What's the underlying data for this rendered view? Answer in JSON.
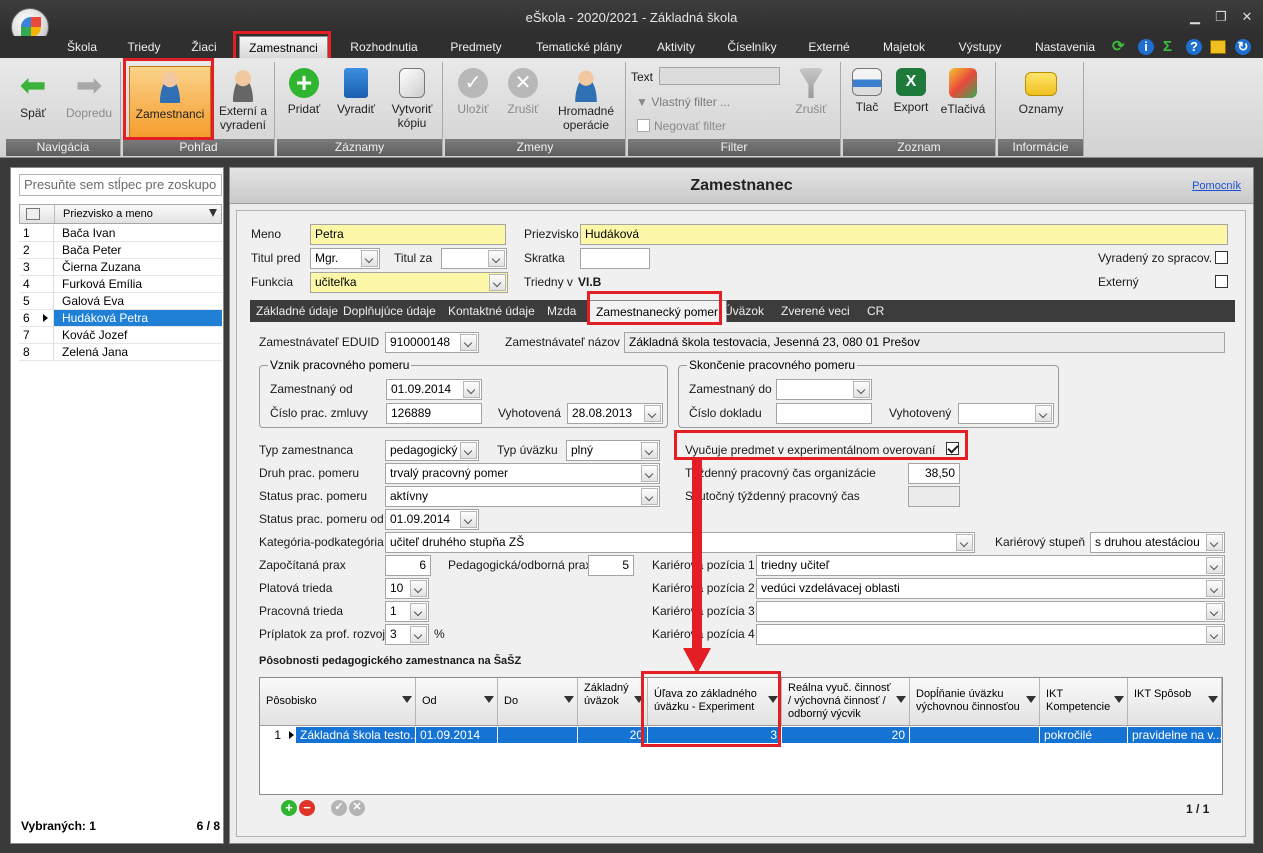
{
  "window": {
    "title": "eŠkola - 2020/2021 - Základná škola"
  },
  "menu": [
    "Škola",
    "Triedy",
    "Žiaci",
    "Zamestnanci",
    "Rozhodnutia",
    "Predmety",
    "Tematické plány",
    "Aktivity",
    "Číselníky",
    "Externé",
    "Majetok",
    "Výstupy",
    "Nastavenia"
  ],
  "ribbon": {
    "groups": [
      "Navigácia",
      "Pohľad",
      "Záznamy",
      "Zmeny",
      "Filter",
      "Zoznam",
      "Informácie"
    ],
    "back": "Späť",
    "forward": "Dopredu",
    "employees": "Zamestnanci",
    "external": "Externí a vyradení",
    "add": "Pridať",
    "remove": "Vyradiť",
    "copy": "Vytvoriť kópiu",
    "save": "Uložiť",
    "cancel": "Zrušiť",
    "bulk": "Hromadné operácie",
    "text_label": "Text",
    "custom_filter": "Vlastný filter ...",
    "negate_filter": "Negovať filter",
    "filter_cancel": "Zrušiť",
    "print": "Tlač",
    "export": "Export",
    "eprint": "eTlačivá",
    "notices": "Oznamy"
  },
  "left": {
    "group_placeholder": "Presuňte sem stĺpec pre zoskupo",
    "column": "Priezvisko a meno",
    "rows": [
      {
        "n": "1",
        "name": "Bača Ivan"
      },
      {
        "n": "2",
        "name": "Bača Peter"
      },
      {
        "n": "3",
        "name": "Čierna Zuzana"
      },
      {
        "n": "4",
        "name": "Furková Emília"
      },
      {
        "n": "5",
        "name": "Galová Eva"
      },
      {
        "n": "6",
        "name": "Hudáková Petra"
      },
      {
        "n": "7",
        "name": "Kováč Jozef"
      },
      {
        "n": "8",
        "name": "Zelená Jana"
      }
    ],
    "selected_label": "Vybraných: 1",
    "count": "6 / 8"
  },
  "main": {
    "title": "Zamestnanec",
    "help": "Pomocník",
    "meno_label": "Meno",
    "meno": "Petra",
    "priezvisko_label": "Priezvisko",
    "priezvisko": "Hudáková",
    "titul_pred_label": "Titul pred",
    "titul_pred": "Mgr.",
    "titul_za_label": "Titul za",
    "titul_za": "",
    "skratka_label": "Skratka",
    "skratka": "",
    "vyradeny_label": "Vyradený zo spracov.",
    "funkcia_label": "Funkcia",
    "funkcia": "učiteľka",
    "triedny_label": "Triedny v",
    "triedny": "VI.B",
    "externy_label": "Externý",
    "tabs": [
      "Základné údaje",
      "Doplňujúce údaje",
      "Kontaktné údaje",
      "Mzda",
      "Zamestnanecký pomer",
      "Úväzok",
      "Zverené veci",
      "CR"
    ]
  },
  "form": {
    "edu_label": "Zamestnávateľ EDUID",
    "edu": "910000148",
    "nazov_label": "Zamestnávateľ názov",
    "nazov": "Základná škola testovacia, Jesenná 23, 080 01 Prešov",
    "vznik_caption": "Vznik pracovného pomeru",
    "od_label": "Zamestnaný od",
    "od": "01.09.2014",
    "zmluva_label": "Číslo prac. zmluvy",
    "zmluva": "126889",
    "vyhot_label": "Vyhotovená",
    "vyhot": "28.08.2013",
    "skonc_caption": "Skončenie pracovného pomeru",
    "do_label": "Zamestnaný do",
    "do": "",
    "doklad_label": "Číslo dokladu",
    "doklad": "",
    "vyhot2_label": "Vyhotovený",
    "vyhot2": "",
    "typ_label": "Typ zamestnanca",
    "typ": "pedagogický",
    "typuv_label": "Typ úväzku",
    "typuv": "plný",
    "druh_label": "Druh prac. pomeru",
    "druh": "trvalý pracovný pomer",
    "status_label": "Status prac. pomeru",
    "status": "aktívny",
    "statusod_label": "Status prac. pomeru od",
    "statusod": "01.09.2014",
    "exp_label": "Vyučuje predmet v experimentálnom overovaní",
    "tyzd_label": "Týždenný pracovný čas organizácie",
    "tyzd": "38,50",
    "skut_label": "Skutočný týždenný pracovný čas",
    "skut": "",
    "kat_label": "Kategória-podkategória",
    "kat": "učiteľ druhého stupňa ZŠ",
    "karst_label": "Kariérový stupeň",
    "karst": "s druhou atestáciou",
    "zap_label": "Započítaná prax",
    "zap": "6",
    "ped_label": "Pedagogická/odborná prax",
    "ped": "5",
    "kp1_label": "Kariérová pozícia 1",
    "kp1": "triedny učiteľ",
    "plat_label": "Platová trieda",
    "plat": "10",
    "kp2_label": "Kariérová pozícia 2",
    "kp2": "vedúci vzdelávacej oblasti",
    "prac_label": "Pracovná trieda",
    "prac": "1",
    "kp3_label": "Kariérová pozícia 3",
    "kp3": "",
    "prip_label": "Príplatok za prof. rozvoj",
    "prip": "3",
    "pct": "%",
    "kp4_label": "Kariérová pozícia 4",
    "kp4": "",
    "section": "Pôsobnosti pedagogického zamestnanca na ŠaŠZ"
  },
  "grid": {
    "headers": [
      "Pôsobisko",
      "Od",
      "Do",
      "Základný úväzok",
      "Úľava zo základného úväzku - Experiment",
      "Reálna vyuč. činnosť / výchovná činnosť / odborný výcvik",
      "Dopĺňanie úväzku výchovnou činnosťou",
      "IKT Kompetencie",
      "IKT Spôsob"
    ],
    "row": {
      "n": "1",
      "posobisko": "Základná škola testo...",
      "od": "01.09.2014",
      "do": "",
      "zakladny": "20",
      "ulava": "3",
      "realna": "20",
      "doplnanie": "",
      "ikt_komp": "pokročilé",
      "ikt_sposob": "pravidelne na v..."
    },
    "paging": "1 / 1"
  }
}
